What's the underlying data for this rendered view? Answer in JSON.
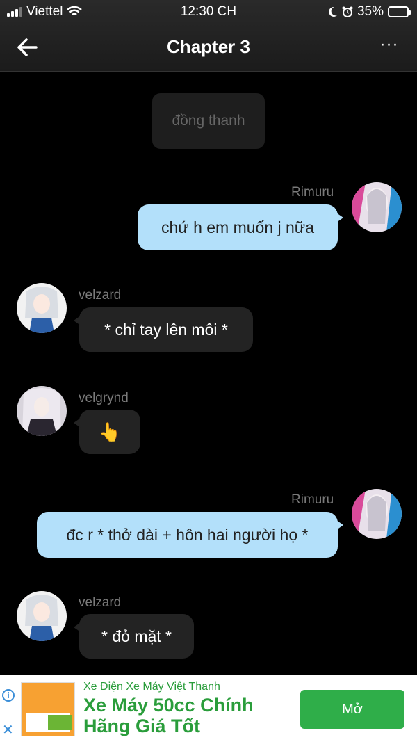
{
  "status_bar": {
    "carrier": "Viettel",
    "time": "12:30 CH",
    "battery": "35%",
    "battery_level": 0.35
  },
  "header": {
    "title": "Chapter 3"
  },
  "messages": [
    {
      "text": "đồng thanh"
    },
    {
      "user": "Rimuru",
      "text": "chứ h em muốn j nữa"
    },
    {
      "user": "velzard",
      "text": "* chỉ tay lên môi *"
    },
    {
      "user": "velgrynd",
      "text": "👆"
    },
    {
      "user": "Rimuru",
      "text": "đc r * thở dài + hôn hai người họ *"
    },
    {
      "user": "velzard",
      "text": "* đỏ mặt *"
    }
  ],
  "ad": {
    "source": "Xe Điện Xe Máy Việt Thanh",
    "headline": "Xe Máy 50cc Chính Hãng Giá Tốt",
    "cta": "Mở",
    "colors": {
      "accent": "#2fae49"
    }
  }
}
